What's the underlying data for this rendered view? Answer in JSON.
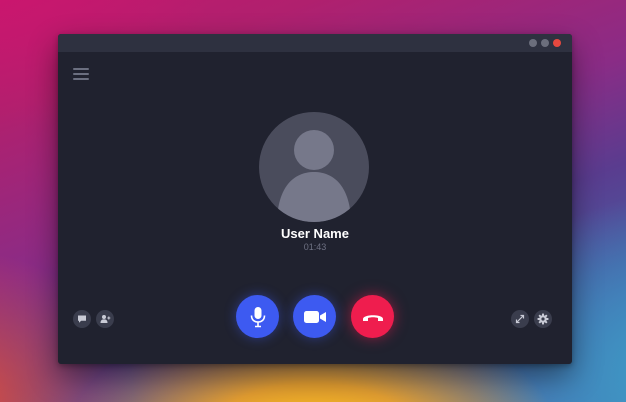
{
  "call": {
    "user_name": "User Name",
    "duration": "01:43"
  },
  "window_controls": [
    {
      "name": "minimize",
      "color": "#6b6e7c"
    },
    {
      "name": "maximize",
      "color": "#6b6e7c"
    },
    {
      "name": "close",
      "color": "#e5483f"
    }
  ],
  "icons": {
    "menu": "hamburger-menu-icon",
    "avatar": "user-silhouette-icon",
    "chat": "chat-bubble-icon",
    "add_user": "add-user-icon",
    "mic": "microphone-icon",
    "video": "video-camera-icon",
    "end_call": "phone-hangup-icon",
    "fullscreen": "expand-arrows-icon",
    "settings": "gear-icon"
  },
  "colors": {
    "window_bg": "#20222f",
    "titlebar_bg": "#2e3140",
    "accent_blue": "#3d5af1",
    "end_call_red": "#ef1d4e",
    "small_button_bg": "#3a3d4d"
  }
}
